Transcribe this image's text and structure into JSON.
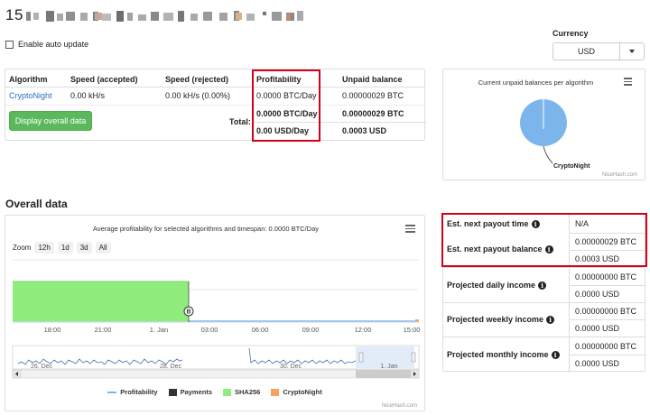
{
  "header": {
    "title_prefix": "15"
  },
  "auto_update": {
    "label": "Enable auto update",
    "checked": false
  },
  "currency": {
    "label": "Currency",
    "selected": "USD"
  },
  "algorithms_table": {
    "columns": [
      "Algorithm",
      "Speed (accepted)",
      "Speed (rejected)",
      "Profitability",
      "Unpaid balance"
    ],
    "rows": [
      {
        "algorithm": "CryptoNight",
        "speed_accepted": "0.00 kH/s",
        "speed_rejected": "0.00 kH/s (0.00%)",
        "profitability": "0.0000 BTC/Day",
        "unpaid_balance": "0.00000029 BTC"
      }
    ],
    "display_button": "Display overall data",
    "total_label": "Total:",
    "total_profitability_btc": "0.0000 BTC/Day",
    "total_unpaid_btc": "0.00000029 BTC",
    "total_profitability_usd": "0.00 USD/Day",
    "total_unpaid_usd": "0.0003 USD"
  },
  "pie_chart": {
    "title": "Current unpaid balances per algorithm",
    "slice_label": "CryptoNight",
    "credit": "NiceHash.com",
    "slice_color": "#7cb5ec"
  },
  "overall": {
    "title": "Overall data",
    "chart_title": "Average profitability for selected algorithms and timespan: 0.0000 BTC/Day",
    "zoom_label": "Zoom",
    "zoom_options": [
      "12h",
      "1d",
      "3d",
      "All"
    ],
    "x_ticks": [
      "18:00",
      "21:00",
      "1. Jan",
      "03:00",
      "06:00",
      "09:00",
      "12:00",
      "15:00"
    ],
    "navigator_ticks": [
      "26. Dec",
      "28. Dec",
      "30. Dec",
      "1. Jan"
    ],
    "legend": [
      "Profitability",
      "Payments",
      "SHA256",
      "CryptoNight"
    ],
    "flag_letter": "B",
    "credit": "NiceHash.com",
    "colors": {
      "profitability": "#7cb5ec",
      "payments": "#333333",
      "sha256": "#90ed7d",
      "cryptonight": "#f7a35c"
    }
  },
  "payout": {
    "next_time_label": "Est. next payout time",
    "next_time_value": "N/A",
    "next_balance_label": "Est. next payout balance",
    "next_balance_btc": "0.00000029 BTC",
    "next_balance_usd": "0.0003 USD",
    "daily_label": "Projected daily income",
    "daily_btc": "0.00000000 BTC",
    "daily_usd": "0.0000 USD",
    "weekly_label": "Projected weekly income",
    "weekly_btc": "0.00000000 BTC",
    "weekly_usd": "0.0000 USD",
    "monthly_label": "Projected monthly income",
    "monthly_btc": "0.00000000 BTC",
    "monthly_usd": "0.0000 USD",
    "info_glyph": "i"
  }
}
